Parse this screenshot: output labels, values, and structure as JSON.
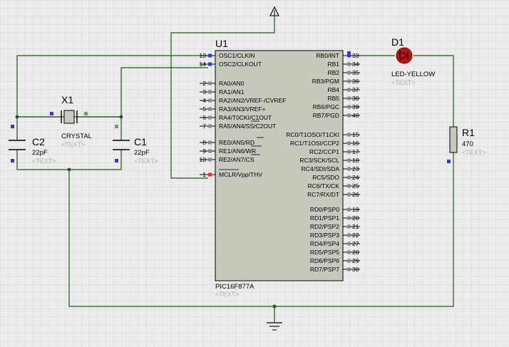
{
  "colors": {
    "background": "#ececec",
    "grid": "#d0d0d0",
    "wire": "#1d5a1d",
    "chip_fill": "#c8c8bc",
    "led_red": "#c01010",
    "placeholder_text": "#b0b0b0",
    "pin_blue": "#2a3ae8",
    "pin_red": "#e03030",
    "pin_gray": "#8a8a8a"
  },
  "mcu": {
    "ref": "U1",
    "part": "PIC16F877A",
    "text": "<TEXT>",
    "left_pins": [
      {
        "num": "13",
        "name": "OSC1/CLKIN"
      },
      {
        "num": "14",
        "name": "OSC2/CLKOUT"
      },
      {
        "num": "2",
        "name": "RA0/AN0"
      },
      {
        "num": "3",
        "name": "RA1/AN1"
      },
      {
        "num": "4",
        "name": "RA2/AN2/VREF-/CVREF"
      },
      {
        "num": "5",
        "name": "RA3/AN3/VREF+"
      },
      {
        "num": "6",
        "name": "RA4/T0CKI/C1OUT"
      },
      {
        "num": "7",
        "name": "RA5/AN4/SS/C2OUT"
      },
      {
        "num": "8",
        "name": "RE0/AN5/RD"
      },
      {
        "num": "9",
        "name": "RE1/AN6/WR"
      },
      {
        "num": "10",
        "name": "RE2/AN7/CS"
      },
      {
        "num": "1",
        "name": "MCLR/Vpp/THV"
      }
    ],
    "right_pins": [
      {
        "num": "33",
        "name": "RB0/INT"
      },
      {
        "num": "34",
        "name": "RB1"
      },
      {
        "num": "35",
        "name": "RB2"
      },
      {
        "num": "36",
        "name": "RB3/PGM"
      },
      {
        "num": "37",
        "name": "RB4"
      },
      {
        "num": "38",
        "name": "RB5"
      },
      {
        "num": "39",
        "name": "RB6/PGC"
      },
      {
        "num": "40",
        "name": "RB7/PGD"
      },
      {
        "num": "15",
        "name": "RC0/T1OSO/T1CKI"
      },
      {
        "num": "16",
        "name": "RC1/T1OSI/CCP2"
      },
      {
        "num": "17",
        "name": "RC2/CCP1"
      },
      {
        "num": "18",
        "name": "RC3/SCK/SCL"
      },
      {
        "num": "23",
        "name": "RC4/SDI/SDA"
      },
      {
        "num": "24",
        "name": "RC5/SDO"
      },
      {
        "num": "25",
        "name": "RC6/TX/CK"
      },
      {
        "num": "26",
        "name": "RC7/RX/DT"
      },
      {
        "num": "19",
        "name": "RD0/PSP0"
      },
      {
        "num": "20",
        "name": "RD1/PSP1"
      },
      {
        "num": "21",
        "name": "RD2/PSP2"
      },
      {
        "num": "22",
        "name": "RD3/PSP3"
      },
      {
        "num": "27",
        "name": "RD4/PSP4"
      },
      {
        "num": "28",
        "name": "RD5/PSP5"
      },
      {
        "num": "29",
        "name": "RD6/PSP6"
      },
      {
        "num": "30",
        "name": "RD7/PSP7"
      }
    ]
  },
  "x1": {
    "ref": "X1",
    "value": "CRYSTAL",
    "text": "<TEXT>"
  },
  "c1": {
    "ref": "C1",
    "value": "22pF",
    "text": "<TEXT>"
  },
  "c2": {
    "ref": "C2",
    "value": "22pF",
    "text": "<TEXT>"
  },
  "d1": {
    "ref": "D1",
    "value": "LED-YELLOW",
    "text": "<TEXT>"
  },
  "r1": {
    "ref": "R1",
    "value": "470",
    "text": "<TEXT>"
  }
}
